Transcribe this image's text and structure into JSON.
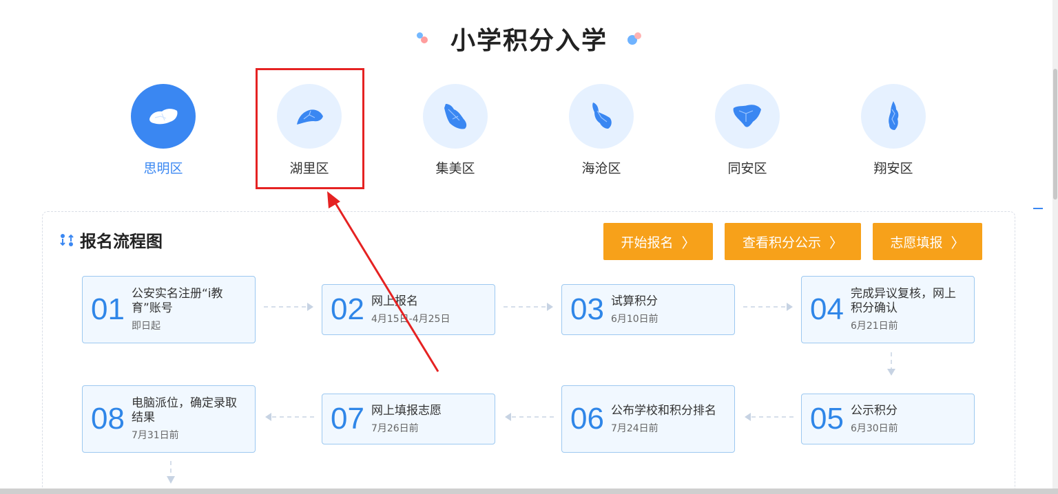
{
  "page": {
    "title": "小学积分入学"
  },
  "districts": [
    {
      "label": "思明区",
      "active": true
    },
    {
      "label": "湖里区",
      "active": false
    },
    {
      "label": "集美区",
      "active": false
    },
    {
      "label": "海沧区",
      "active": false
    },
    {
      "label": "同安区",
      "active": false
    },
    {
      "label": "翔安区",
      "active": false
    }
  ],
  "panel": {
    "title": "报名流程图"
  },
  "buttons": {
    "start": "开始报名",
    "view_scores": "查看积分公示",
    "preference": "志愿填报",
    "chevron": "〉"
  },
  "steps": [
    {
      "num": "01",
      "name": "公安实名注册“i教育”账号",
      "date": "即日起"
    },
    {
      "num": "02",
      "name": "网上报名",
      "date": "4月15日-4月25日"
    },
    {
      "num": "03",
      "name": "试算积分",
      "date": "6月10日前"
    },
    {
      "num": "04",
      "name": "完成异议复核，网上积分确认",
      "date": "6月21日前"
    },
    {
      "num": "05",
      "name": "公示积分",
      "date": "6月30日前"
    },
    {
      "num": "06",
      "name": "公布学校和积分排名",
      "date": "7月24日前"
    },
    {
      "num": "07",
      "name": "网上填报志愿",
      "date": "7月26日前"
    },
    {
      "num": "08",
      "name": "电脑派位，确定录取结果",
      "date": "7月31日前"
    }
  ],
  "colors": {
    "accent": "#3a87f2",
    "button": "#f7a11a",
    "highlight": "#e52222",
    "step_bg": "#f1f8ff"
  },
  "icons": {
    "flow": "flow-chart-icon",
    "district_map": "district-map-icon"
  }
}
